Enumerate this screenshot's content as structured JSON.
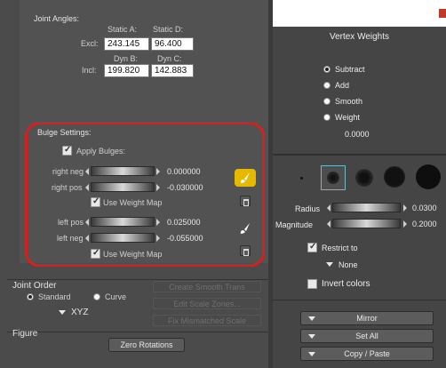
{
  "joint_angles": {
    "header": "Joint Angles:",
    "static_a_label": "Static A:",
    "static_d_label": "Static D:",
    "excl_label": "Excl:",
    "excl_a": "243.145",
    "excl_d": "96.400",
    "dyn_b_label": "Dyn B:",
    "dyn_c_label": "Dyn C:",
    "incl_label": "Incl:",
    "incl_b": "199.820",
    "incl_c": "142.883"
  },
  "bulge": {
    "header": "Bulge Settings:",
    "apply_label": "Apply Bulges:",
    "right_neg_label": "right neg",
    "right_neg_value": "0.000000",
    "right_pos_label": "right pos",
    "right_pos_value": "-0.030000",
    "use_weight_map_label": "Use Weight Map",
    "left_pos_label": "left pos",
    "left_pos_value": "0.025000",
    "left_neg_label": "left neg",
    "left_neg_value": "-0.055000",
    "use_weight_map_label_2": "Use Weight Map",
    "highlight_color": "#d42020",
    "brush_active_color": "#e6b800"
  },
  "joint_order": {
    "header": "Joint Order",
    "standard_label": "Standard",
    "curve_label": "Curve",
    "order_value": "XYZ",
    "create_smooth_label": "Create Smooth Trans",
    "edit_scale_label": "Edit Scale Zones...",
    "fix_scale_label": "Fix Mismatched Scale"
  },
  "figure": {
    "header": "Figure",
    "zero_rotations_label": "Zero Rotations"
  },
  "vertex_weights": {
    "title": "Vertex Weights",
    "modes": [
      "Subtract",
      "Add",
      "Smooth",
      "Weight"
    ],
    "weight_value": "0.0000",
    "radius_label": "Radius",
    "radius_value": "0.0300",
    "magnitude_label": "Magnitude",
    "magnitude_value": "0.2000",
    "restrict_label": "Restrict to",
    "restrict_value": "None",
    "invert_label": "Invert colors",
    "mirror_label": "Mirror",
    "set_all_label": "Set All",
    "copy_paste_label": "Copy / Paste"
  }
}
